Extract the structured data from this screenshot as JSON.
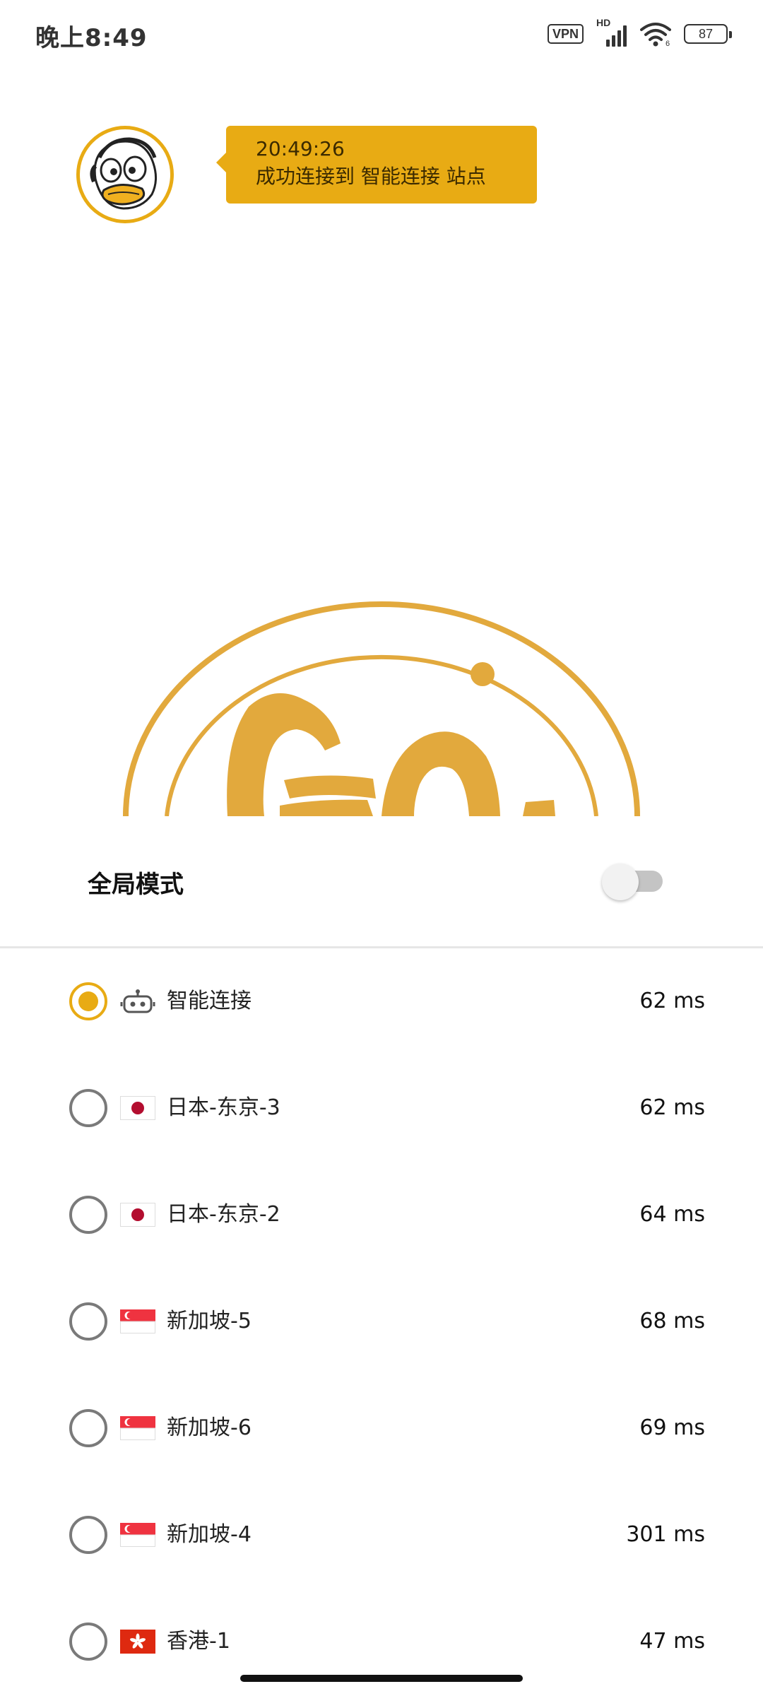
{
  "status_bar": {
    "time": "晚上8:49",
    "vpn": "VPN",
    "network": "HD",
    "wifi_sub": "6",
    "battery": "87"
  },
  "notification": {
    "time": "20:49:26",
    "message": "成功连接到 智能连接 站点"
  },
  "global_mode": {
    "label": "全局模式",
    "enabled": false
  },
  "servers": [
    {
      "name": "智能连接",
      "latency": "62 ms",
      "icon": "robot-icon",
      "selected": true
    },
    {
      "name": "日本-东京-3",
      "latency": "62 ms",
      "icon": "japan-flag-icon",
      "selected": false
    },
    {
      "name": "日本-东京-2",
      "latency": "64 ms",
      "icon": "japan-flag-icon",
      "selected": false
    },
    {
      "name": "新加坡-5",
      "latency": "68 ms",
      "icon": "singapore-flag-icon",
      "selected": false
    },
    {
      "name": "新加坡-6",
      "latency": "69 ms",
      "icon": "singapore-flag-icon",
      "selected": false
    },
    {
      "name": "新加坡-4",
      "latency": "301 ms",
      "icon": "singapore-flag-icon",
      "selected": false
    },
    {
      "name": "香港-1",
      "latency": "47 ms",
      "icon": "hongkong-flag-icon",
      "selected": false
    }
  ],
  "colors": {
    "accent": "#e8ab14",
    "logo": "#e2a93d",
    "radio_inactive": "#7a7a7a"
  }
}
